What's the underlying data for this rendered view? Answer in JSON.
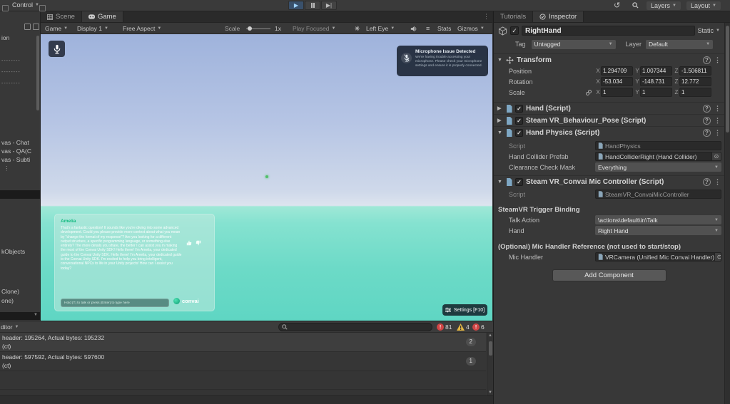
{
  "colors": {
    "sky_top": "#9fb3dc",
    "sky_horizon": "#dde4ef",
    "water_top": "#9fe8d7",
    "water_bottom": "#5fd6c3",
    "convai_green": "#12b97f",
    "error_red": "#d14545",
    "warning_yellow": "#e2b644",
    "play_active_blue": "#39506b"
  },
  "menubar": {
    "control": "Control",
    "layers": "Layers",
    "layout": "Layout"
  },
  "hierarchy": {
    "items": [
      "ion",
      "--------",
      "--------",
      "--------",
      "vas - Chat",
      "vas - QA(C",
      "vas - Subti",
      "kObjects",
      "Clone)",
      "one)"
    ]
  },
  "game": {
    "tabs": {
      "scene": "Scene",
      "game": "Game"
    },
    "toolbar": {
      "game_menu": "Game",
      "display": "Display 1",
      "aspect": "Free Aspect",
      "scale_label": "Scale",
      "scale_value": "1x",
      "play_focused": "Play Focused",
      "eye": "Left Eye",
      "stats": "Stats",
      "gizmos": "Gizmos"
    },
    "mic_notification": {
      "title": "Microphone Issue Detected",
      "body": "We're having trouble accessing your microphone. Please check your microphone settings and ensure it is properly connected."
    },
    "chat": {
      "speaker": "Amelia",
      "message": "That's a fantastic question! It sounds like you're diving into some advanced development. Could you please provide more context about what you mean by \"change the format of my response\"? Are you looking for a different output structure, a specific programming language, or something else entirely? The more details you share, the better I can assist you in making the most of the Convai Unity SDK! Hello there! I'm Amelia, your dedicated guide to the Convai Unity SDK. Hello there! I'm Amelia, your dedicated guide to the Convai Unity SDK. I'm excited to help you bring intelligent, conversational NPCs to life in your Unity projects! How can I assist you today?",
      "input_placeholder": "Hold [T] to talk or press [Enter] to type here",
      "logo_text": "convai"
    },
    "settings_button": "Settings [F10]"
  },
  "inspector": {
    "tabs": {
      "tutorials": "Tutorials",
      "inspector": "Inspector"
    },
    "header": {
      "name": "RightHand",
      "static_label": "Static"
    },
    "tag_layer": {
      "tag_label": "Tag",
      "tag_value": "Untagged",
      "layer_label": "Layer",
      "layer_value": "Default"
    },
    "axes": {
      "x": "X",
      "y": "Y",
      "z": "Z"
    },
    "transform": {
      "title": "Transform",
      "position": {
        "label": "Position",
        "x": "1.294709",
        "y": "1.007344",
        "z": "-1.506811"
      },
      "rotation": {
        "label": "Rotation",
        "x": "-53.034",
        "y": "-148.731",
        "z": "12.772"
      },
      "scale": {
        "label": "Scale",
        "x": "1",
        "y": "1",
        "z": "1"
      }
    },
    "hand_component": {
      "title": "Hand (Script)"
    },
    "pose_component": {
      "title": "Steam VR_Behaviour_Pose (Script)"
    },
    "hand_physics": {
      "title": "Hand Physics (Script)",
      "script_label": "Script",
      "script_value": "HandPhysics",
      "collider_label": "Hand Collider Prefab",
      "collider_value": "HandColliderRight (Hand Collider)",
      "mask_label": "Clearance Check Mask",
      "mask_value": "Everything"
    },
    "mic_controller": {
      "title": "Steam VR_Convai Mic Controller (Script)",
      "script_label": "Script",
      "script_value": "SteamVR_ConvaiMicController",
      "binding_section": "SteamVR Trigger Binding",
      "talk_label": "Talk Action",
      "talk_value": "\\actions\\default\\in\\Talk",
      "hand_label": "Hand",
      "hand_value": "Right Hand",
      "handler_section": "(Optional) Mic Handler Reference (not used to start/stop)",
      "handler_label": "Mic Handler",
      "handler_value": "VRCamera (Unified Mic Convai Handler)"
    },
    "add_component": "Add Component"
  },
  "console": {
    "editor_dropdown": "ditor",
    "counts": {
      "errors": "81",
      "warnings": "4",
      "errors2": "6"
    },
    "entries": [
      {
        "line1": "header: 195264, Actual bytes: 195232",
        "line2": "(ct)",
        "badge": "2"
      },
      {
        "line1": "header: 597592, Actual bytes: 597600",
        "line2": "(ct)",
        "badge": "1"
      }
    ]
  }
}
